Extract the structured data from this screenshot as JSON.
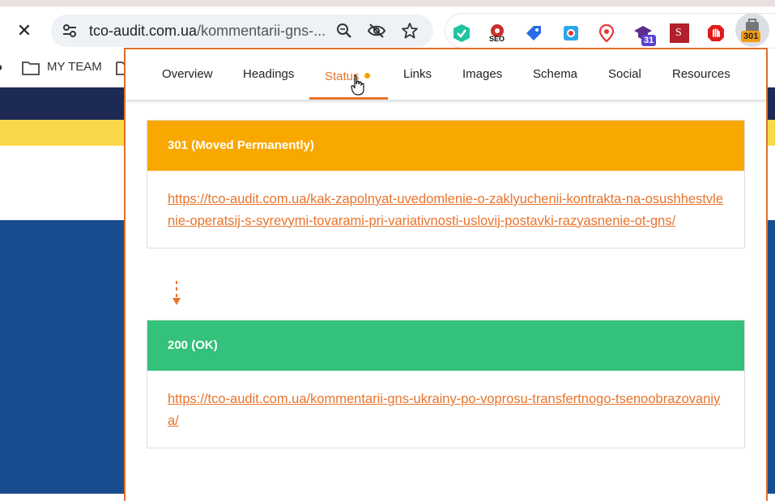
{
  "browser": {
    "url_host": "tco-audit.com.ua",
    "url_path": "/kommentarii-gns-...",
    "extensions": [
      {
        "name": "check-ext"
      },
      {
        "name": "seo-ext",
        "label": "SEO"
      },
      {
        "name": "tag-ext"
      },
      {
        "name": "camera-ext"
      },
      {
        "name": "pin-ext"
      },
      {
        "name": "cap-ext",
        "badge": "31"
      },
      {
        "name": "s-ext",
        "label": "S"
      },
      {
        "name": "hand-ext"
      },
      {
        "name": "status-ext",
        "badge": "301"
      }
    ]
  },
  "bookmarks": {
    "items": [
      {
        "label": "MY TEAM"
      }
    ]
  },
  "popup": {
    "tabs": [
      {
        "label": "Overview"
      },
      {
        "label": "Headings"
      },
      {
        "label": "Status",
        "active": true
      },
      {
        "label": "Links"
      },
      {
        "label": "Images"
      },
      {
        "label": "Schema"
      },
      {
        "label": "Social"
      },
      {
        "label": "Resources"
      }
    ],
    "redirects": [
      {
        "status": "301 (Moved Permanently)",
        "url": "https://tco-audit.com.ua/kak-zapolnyat-uvedomlenie-o-zaklyuchenii-kontrakta-na-osushhestvlenie-operatsij-s-syrevymi-tovarami-pri-variativnosti-uslovij-postavki-razyasnenie-ot-gns/",
        "color": "#f9a800"
      },
      {
        "status": "200 (OK)",
        "url": "https://tco-audit.com.ua/kommentarii-gns-ukrainy-po-voprosu-transfertnogo-tsenoobrazovaniya/",
        "color": "#33c17b"
      }
    ],
    "accent_color": "#e8742c"
  }
}
